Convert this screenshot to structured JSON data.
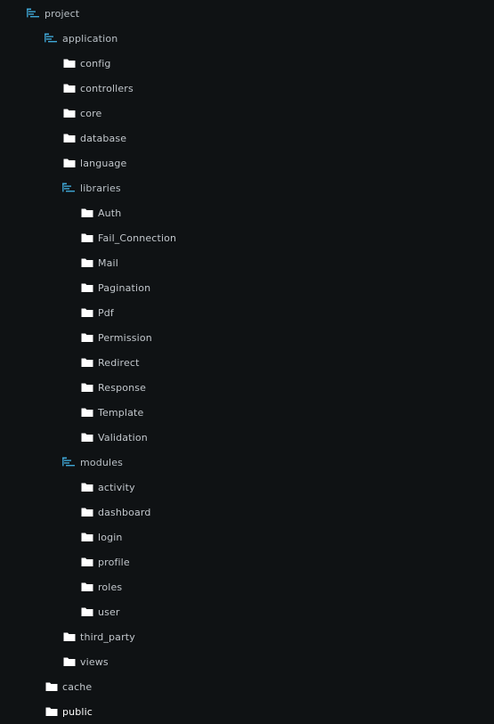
{
  "colors": {
    "background": "#0f1214",
    "text": "#c2c7cc",
    "expanded_icon": "#3fa7d6",
    "folder_icon": "#ffffff"
  },
  "tree": [
    {
      "label": "project",
      "depth": 0,
      "expanded": true,
      "icon": "folder-open-list-icon"
    },
    {
      "label": "application",
      "depth": 1,
      "expanded": true,
      "icon": "folder-open-list-icon"
    },
    {
      "label": "config",
      "depth": 2,
      "expanded": false,
      "icon": "folder-icon"
    },
    {
      "label": "controllers",
      "depth": 2,
      "expanded": false,
      "icon": "folder-icon"
    },
    {
      "label": "core",
      "depth": 2,
      "expanded": false,
      "icon": "folder-icon"
    },
    {
      "label": "database",
      "depth": 2,
      "expanded": false,
      "icon": "folder-icon"
    },
    {
      "label": "language",
      "depth": 2,
      "expanded": false,
      "icon": "folder-icon"
    },
    {
      "label": "libraries",
      "depth": 2,
      "expanded": true,
      "icon": "folder-open-list-icon"
    },
    {
      "label": "Auth",
      "depth": 3,
      "expanded": false,
      "icon": "folder-icon"
    },
    {
      "label": "Fail_Connection",
      "depth": 3,
      "expanded": false,
      "icon": "folder-icon"
    },
    {
      "label": "Mail",
      "depth": 3,
      "expanded": false,
      "icon": "folder-icon"
    },
    {
      "label": "Pagination",
      "depth": 3,
      "expanded": false,
      "icon": "folder-icon"
    },
    {
      "label": "Pdf",
      "depth": 3,
      "expanded": false,
      "icon": "folder-icon"
    },
    {
      "label": "Permission",
      "depth": 3,
      "expanded": false,
      "icon": "folder-icon"
    },
    {
      "label": "Redirect",
      "depth": 3,
      "expanded": false,
      "icon": "folder-icon"
    },
    {
      "label": "Response",
      "depth": 3,
      "expanded": false,
      "icon": "folder-icon"
    },
    {
      "label": "Template",
      "depth": 3,
      "expanded": false,
      "icon": "folder-icon"
    },
    {
      "label": "Validation",
      "depth": 3,
      "expanded": false,
      "icon": "folder-icon"
    },
    {
      "label": "modules",
      "depth": 2,
      "expanded": true,
      "icon": "folder-open-list-icon"
    },
    {
      "label": "activity",
      "depth": 3,
      "expanded": false,
      "icon": "folder-icon"
    },
    {
      "label": "dashboard",
      "depth": 3,
      "expanded": false,
      "icon": "folder-icon"
    },
    {
      "label": "login",
      "depth": 3,
      "expanded": false,
      "icon": "folder-icon"
    },
    {
      "label": "profile",
      "depth": 3,
      "expanded": false,
      "icon": "folder-icon"
    },
    {
      "label": "roles",
      "depth": 3,
      "expanded": false,
      "icon": "folder-icon"
    },
    {
      "label": "user",
      "depth": 3,
      "expanded": false,
      "icon": "folder-icon"
    },
    {
      "label": "third_party",
      "depth": 2,
      "expanded": false,
      "icon": "folder-icon"
    },
    {
      "label": "views",
      "depth": 2,
      "expanded": false,
      "icon": "folder-icon"
    },
    {
      "label": "cache",
      "depth": 1,
      "expanded": false,
      "icon": "folder-icon"
    },
    {
      "label": "public",
      "depth": 1,
      "expanded": false,
      "icon": "folder-icon",
      "bright": true
    }
  ]
}
